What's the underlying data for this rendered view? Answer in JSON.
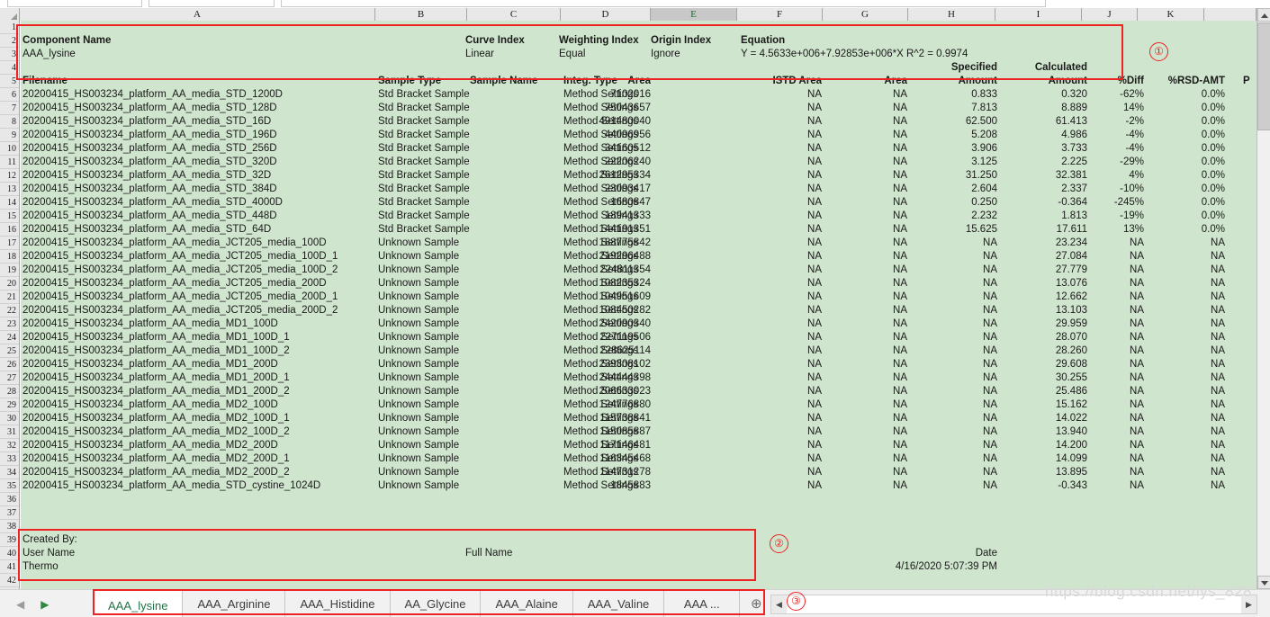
{
  "spreadsheet": {
    "column_letters": [
      "A",
      "B",
      "C",
      "D",
      "E",
      "F",
      "G",
      "H",
      "I",
      "J",
      "K"
    ],
    "selected_column": "E",
    "truncated_right_column": "P",
    "row_numbers": [
      1,
      2,
      3,
      4,
      5,
      6,
      7,
      8,
      9,
      10,
      11,
      12,
      13,
      14,
      15,
      16,
      17,
      18,
      19,
      20,
      21,
      22,
      23,
      24,
      25,
      26,
      27,
      28,
      29,
      30,
      31,
      32,
      33,
      34,
      35,
      36,
      37,
      38,
      39,
      40,
      41,
      42
    ],
    "sheet_background": "#cfe5cd",
    "annotation_color": "#ee2222"
  },
  "info_block": {
    "component_name_label": "Component Name",
    "component_name_value": "AAA_lysine",
    "curve_index_label": "Curve Index",
    "curve_index_value": "Linear",
    "weighting_index_label": "Weighting Index",
    "weighting_index_value": "Equal",
    "origin_index_label": "Origin Index",
    "origin_index_value": "Ignore",
    "equation_label": "Equation",
    "equation_value": "Y = 4.5633e+006+7.92853e+006*X   R^2 = 0.9974",
    "specified_label": "Specified",
    "calculated_label": "Calculated"
  },
  "table": {
    "headers": [
      "Filename",
      "Sample Type",
      "Sample Name",
      "Integ. Type",
      "Area",
      "ISTD Area",
      "Area",
      "Amount",
      "Amount",
      "%Diff",
      "%RSD-AMT",
      "P"
    ],
    "rows": [
      {
        "n": 6,
        "filename": "20200415_HS003234_platform_AA_media_STD_1200D",
        "sample_type": "Std Bracket Sample",
        "sample_name": "",
        "integ_type": "Method Settings",
        "area": "7102016",
        "istd_area": "NA",
        "istd_area2": "NA",
        "spec_amount": "0.833",
        "calc_amount": "0.320",
        "pct_diff": "-62%",
        "pct_rsd": "0.0%"
      },
      {
        "n": 7,
        "filename": "20200415_HS003234_platform_AA_media_STD_128D",
        "sample_type": "Std Bracket Sample",
        "sample_name": "",
        "integ_type": "Method Settings",
        "area": "75043657",
        "istd_area": "NA",
        "istd_area2": "NA",
        "spec_amount": "7.813",
        "calc_amount": "8.889",
        "pct_diff": "14%",
        "pct_rsd": "0.0%"
      },
      {
        "n": 8,
        "filename": "20200415_HS003234_platform_AA_media_STD_16D",
        "sample_type": "Std Bracket Sample",
        "sample_name": "",
        "integ_type": "Method Settings",
        "area": "491480040",
        "istd_area": "NA",
        "istd_area2": "NA",
        "spec_amount": "62.500",
        "calc_amount": "61.413",
        "pct_diff": "-2%",
        "pct_rsd": "0.0%"
      },
      {
        "n": 9,
        "filename": "20200415_HS003234_platform_AA_media_STD_196D",
        "sample_type": "Std Bracket Sample",
        "sample_name": "",
        "integ_type": "Method Settings",
        "area": "44096956",
        "istd_area": "NA",
        "istd_area2": "NA",
        "spec_amount": "5.208",
        "calc_amount": "4.986",
        "pct_diff": "-4%",
        "pct_rsd": "0.0%"
      },
      {
        "n": 10,
        "filename": "20200415_HS003234_platform_AA_media_STD_256D",
        "sample_type": "Std Bracket Sample",
        "sample_name": "",
        "integ_type": "Method Settings",
        "area": "34160512",
        "istd_area": "NA",
        "istd_area2": "NA",
        "spec_amount": "3.906",
        "calc_amount": "3.733",
        "pct_diff": "-4%",
        "pct_rsd": "0.0%"
      },
      {
        "n": 11,
        "filename": "20200415_HS003234_platform_AA_media_STD_320D",
        "sample_type": "Std Bracket Sample",
        "sample_name": "",
        "integ_type": "Method Settings",
        "area": "22206240",
        "istd_area": "NA",
        "istd_area2": "NA",
        "spec_amount": "3.125",
        "calc_amount": "2.225",
        "pct_diff": "-29%",
        "pct_rsd": "0.0%"
      },
      {
        "n": 12,
        "filename": "20200415_HS003234_platform_AA_media_STD_32D",
        "sample_type": "Std Bracket Sample",
        "sample_name": "",
        "integ_type": "Method Settings",
        "area": "261295334",
        "istd_area": "NA",
        "istd_area2": "NA",
        "spec_amount": "31.250",
        "calc_amount": "32.381",
        "pct_diff": "4%",
        "pct_rsd": "0.0%"
      },
      {
        "n": 13,
        "filename": "20200415_HS003234_platform_AA_media_STD_384D",
        "sample_type": "Std Bracket Sample",
        "sample_name": "",
        "integ_type": "Method Settings",
        "area": "23093417",
        "istd_area": "NA",
        "istd_area2": "NA",
        "spec_amount": "2.604",
        "calc_amount": "2.337",
        "pct_diff": "-10%",
        "pct_rsd": "0.0%"
      },
      {
        "n": 14,
        "filename": "20200415_HS003234_platform_AA_media_STD_4000D",
        "sample_type": "Std Bracket Sample",
        "sample_name": "",
        "integ_type": "Method Settings",
        "area": "1680847",
        "istd_area": "NA",
        "istd_area2": "NA",
        "spec_amount": "0.250",
        "calc_amount": "-0.364",
        "pct_diff": "-245%",
        "pct_rsd": "0.0%"
      },
      {
        "n": 15,
        "filename": "20200415_HS003234_platform_AA_media_STD_448D",
        "sample_type": "Std Bracket Sample",
        "sample_name": "",
        "integ_type": "Method Settings",
        "area": "18941333",
        "istd_area": "NA",
        "istd_area2": "NA",
        "spec_amount": "2.232",
        "calc_amount": "1.813",
        "pct_diff": "-19%",
        "pct_rsd": "0.0%"
      },
      {
        "n": 16,
        "filename": "20200415_HS003234_platform_AA_media_STD_64D",
        "sample_type": "Std Bracket Sample",
        "sample_name": "",
        "integ_type": "Method Settings",
        "area": "144191351",
        "istd_area": "NA",
        "istd_area2": "NA",
        "spec_amount": "15.625",
        "calc_amount": "17.611",
        "pct_diff": "13%",
        "pct_rsd": "0.0%"
      },
      {
        "n": 17,
        "filename": "20200415_HS003234_platform_AA_media_JCT205_media_100D",
        "sample_type": "Unknown Sample",
        "sample_name": "",
        "integ_type": "Method Settings",
        "area": "188775842",
        "istd_area": "NA",
        "istd_area2": "NA",
        "spec_amount": "NA",
        "calc_amount": "23.234",
        "pct_diff": "NA",
        "pct_rsd": "NA"
      },
      {
        "n": 18,
        "filename": "20200415_HS003234_platform_AA_media_JCT205_media_100D_1",
        "sample_type": "Unknown Sample",
        "sample_name": "",
        "integ_type": "Method Settings",
        "area": "219296488",
        "istd_area": "NA",
        "istd_area2": "NA",
        "spec_amount": "NA",
        "calc_amount": "27.084",
        "pct_diff": "NA",
        "pct_rsd": "NA"
      },
      {
        "n": 19,
        "filename": "20200415_HS003234_platform_AA_media_JCT205_media_100D_2",
        "sample_type": "Unknown Sample",
        "sample_name": "",
        "integ_type": "Method Settings",
        "area": "224811354",
        "istd_area": "NA",
        "istd_area2": "NA",
        "spec_amount": "NA",
        "calc_amount": "27.779",
        "pct_diff": "NA",
        "pct_rsd": "NA"
      },
      {
        "n": 20,
        "filename": "20200415_HS003234_platform_AA_media_JCT205_media_200D",
        "sample_type": "Unknown Sample",
        "sample_name": "",
        "integ_type": "Method Settings",
        "area": "108235324",
        "istd_area": "NA",
        "istd_area2": "NA",
        "spec_amount": "NA",
        "calc_amount": "13.076",
        "pct_diff": "NA",
        "pct_rsd": "NA"
      },
      {
        "n": 21,
        "filename": "20200415_HS003234_platform_AA_media_JCT205_media_200D_1",
        "sample_type": "Unknown Sample",
        "sample_name": "",
        "integ_type": "Method Settings",
        "area": "104951609",
        "istd_area": "NA",
        "istd_area2": "NA",
        "spec_amount": "NA",
        "calc_amount": "12.662",
        "pct_diff": "NA",
        "pct_rsd": "NA"
      },
      {
        "n": 22,
        "filename": "20200415_HS003234_platform_AA_media_JCT205_media_200D_2",
        "sample_type": "Unknown Sample",
        "sample_name": "",
        "integ_type": "Method Settings",
        "area": "108450282",
        "istd_area": "NA",
        "istd_area2": "NA",
        "spec_amount": "NA",
        "calc_amount": "13.103",
        "pct_diff": "NA",
        "pct_rsd": "NA"
      },
      {
        "n": 23,
        "filename": "20200415_HS003234_platform_AA_media_MD1_100D",
        "sample_type": "Unknown Sample",
        "sample_name": "",
        "integ_type": "Method Settings",
        "area": "242090340",
        "istd_area": "NA",
        "istd_area2": "NA",
        "spec_amount": "NA",
        "calc_amount": "29.959",
        "pct_diff": "NA",
        "pct_rsd": "NA"
      },
      {
        "n": 24,
        "filename": "20200415_HS003234_platform_AA_media_MD1_100D_1",
        "sample_type": "Unknown Sample",
        "sample_name": "",
        "integ_type": "Method Settings",
        "area": "227119506",
        "istd_area": "NA",
        "istd_area2": "NA",
        "spec_amount": "NA",
        "calc_amount": "28.070",
        "pct_diff": "NA",
        "pct_rsd": "NA"
      },
      {
        "n": 25,
        "filename": "20200415_HS003234_platform_AA_media_MD1_100D_2",
        "sample_type": "Unknown Sample",
        "sample_name": "",
        "integ_type": "Method Settings",
        "area": "228625114",
        "istd_area": "NA",
        "istd_area2": "NA",
        "spec_amount": "NA",
        "calc_amount": "28.260",
        "pct_diff": "NA",
        "pct_rsd": "NA"
      },
      {
        "n": 26,
        "filename": "20200415_HS003234_platform_AA_media_MD1_200D",
        "sample_type": "Unknown Sample",
        "sample_name": "",
        "integ_type": "Method Settings",
        "area": "239308102",
        "istd_area": "NA",
        "istd_area2": "NA",
        "spec_amount": "NA",
        "calc_amount": "29.608",
        "pct_diff": "NA",
        "pct_rsd": "NA"
      },
      {
        "n": 27,
        "filename": "20200415_HS003234_platform_AA_media_MD1_200D_1",
        "sample_type": "Unknown Sample",
        "sample_name": "",
        "integ_type": "Method Settings",
        "area": "244444398",
        "istd_area": "NA",
        "istd_area2": "NA",
        "spec_amount": "NA",
        "calc_amount": "30.255",
        "pct_diff": "NA",
        "pct_rsd": "NA"
      },
      {
        "n": 28,
        "filename": "20200415_HS003234_platform_AA_media_MD1_200D_2",
        "sample_type": "Unknown Sample",
        "sample_name": "",
        "integ_type": "Method Settings",
        "area": "206633023",
        "istd_area": "NA",
        "istd_area2": "NA",
        "spec_amount": "NA",
        "calc_amount": "25.486",
        "pct_diff": "NA",
        "pct_rsd": "NA"
      },
      {
        "n": 29,
        "filename": "20200415_HS003234_platform_AA_media_MD2_100D",
        "sample_type": "Unknown Sample",
        "sample_name": "",
        "integ_type": "Method Settings",
        "area": "124776880",
        "istd_area": "NA",
        "istd_area2": "NA",
        "spec_amount": "NA",
        "calc_amount": "15.162",
        "pct_diff": "NA",
        "pct_rsd": "NA"
      },
      {
        "n": 30,
        "filename": "20200415_HS003234_platform_AA_media_MD2_100D_1",
        "sample_type": "Unknown Sample",
        "sample_name": "",
        "integ_type": "Method Settings",
        "area": "115738841",
        "istd_area": "NA",
        "istd_area2": "NA",
        "spec_amount": "NA",
        "calc_amount": "14.022",
        "pct_diff": "NA",
        "pct_rsd": "NA"
      },
      {
        "n": 31,
        "filename": "20200415_HS003234_platform_AA_media_MD2_100D_2",
        "sample_type": "Unknown Sample",
        "sample_name": "",
        "integ_type": "Method Settings",
        "area": "115085887",
        "istd_area": "NA",
        "istd_area2": "NA",
        "spec_amount": "NA",
        "calc_amount": "13.940",
        "pct_diff": "NA",
        "pct_rsd": "NA"
      },
      {
        "n": 32,
        "filename": "20200415_HS003234_platform_AA_media_MD2_200D",
        "sample_type": "Unknown Sample",
        "sample_name": "",
        "integ_type": "Method Settings",
        "area": "117146481",
        "istd_area": "NA",
        "istd_area2": "NA",
        "spec_amount": "NA",
        "calc_amount": "14.200",
        "pct_diff": "NA",
        "pct_rsd": "NA"
      },
      {
        "n": 33,
        "filename": "20200415_HS003234_platform_AA_media_MD2_200D_1",
        "sample_type": "Unknown Sample",
        "sample_name": "",
        "integ_type": "Method Settings",
        "area": "116345468",
        "istd_area": "NA",
        "istd_area2": "NA",
        "spec_amount": "NA",
        "calc_amount": "14.099",
        "pct_diff": "NA",
        "pct_rsd": "NA"
      },
      {
        "n": 34,
        "filename": "20200415_HS003234_platform_AA_media_MD2_200D_2",
        "sample_type": "Unknown Sample",
        "sample_name": "",
        "integ_type": "Method Settings",
        "area": "114731278",
        "istd_area": "NA",
        "istd_area2": "NA",
        "spec_amount": "NA",
        "calc_amount": "13.895",
        "pct_diff": "NA",
        "pct_rsd": "NA"
      },
      {
        "n": 35,
        "filename": "20200415_HS003234_platform_AA_media_STD_cystine_1024D",
        "sample_type": "Unknown Sample",
        "sample_name": "",
        "integ_type": "Method Settings",
        "area": "1845883",
        "istd_area": "NA",
        "istd_area2": "NA",
        "spec_amount": "NA",
        "calc_amount": "-0.343",
        "pct_diff": "NA",
        "pct_rsd": "NA"
      }
    ]
  },
  "footer": {
    "created_by_label": "Created By:",
    "user_name_label": "User Name",
    "full_name_label": "Full Name",
    "date_label": "Date",
    "user_name_value": "Thermo",
    "date_value": "4/16/2020 5:07:39 PM"
  },
  "tabs": {
    "items": [
      {
        "label": "AAA_lysine",
        "active": true
      },
      {
        "label": "AAA_Arginine",
        "active": false
      },
      {
        "label": "AAA_Histidine",
        "active": false
      },
      {
        "label": "AA_Glycine",
        "active": false
      },
      {
        "label": "AAA_Alaine",
        "active": false
      },
      {
        "label": "AAA_Valine",
        "active": false
      },
      {
        "label": "AAA  ...",
        "active": false
      }
    ],
    "add_label": "⊕",
    "prev_arrow": "◀",
    "next_arrow": "▶"
  },
  "scrollbars": {
    "up_arrow": "▲",
    "down_arrow": "▼",
    "left_arrow": "◀",
    "right_arrow": "▶"
  },
  "annotations": [
    {
      "id": "1",
      "glyph": "①"
    },
    {
      "id": "2",
      "glyph": "②"
    },
    {
      "id": "3",
      "glyph": "③"
    }
  ],
  "watermark": "https://blog.csdn.net/lys_828"
}
